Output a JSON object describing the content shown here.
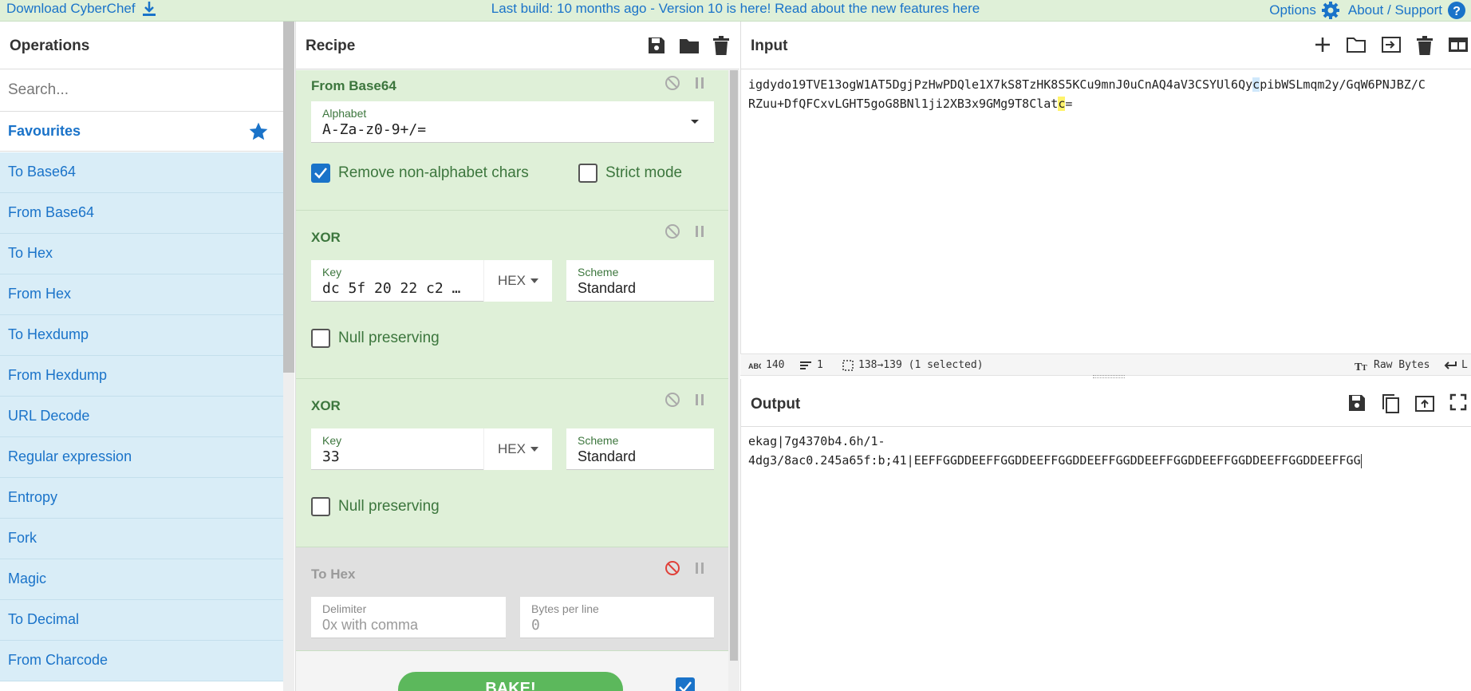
{
  "banner": {
    "download": "Download CyberChef",
    "message": "Last build: 10 months ago - Version 10 is here! Read about the new features here",
    "options": "Options",
    "about": "About / Support"
  },
  "operations": {
    "title": "Operations",
    "search_placeholder": "Search...",
    "favourites": "Favourites",
    "items": [
      "To Base64",
      "From Base64",
      "To Hex",
      "From Hex",
      "To Hexdump",
      "From Hexdump",
      "URL Decode",
      "Regular expression",
      "Entropy",
      "Fork",
      "Magic",
      "To Decimal",
      "From Charcode"
    ]
  },
  "recipe": {
    "title": "Recipe",
    "ops": [
      {
        "name": "From Base64",
        "alphabet_label": "Alphabet",
        "alphabet_value": "A-Za-z0-9+/=",
        "remove_label": "Remove non-alphabet chars",
        "strict_label": "Strict mode"
      },
      {
        "name": "XOR",
        "key_label": "Key",
        "key_value": "dc 5f 20 22 c2 …",
        "key_format": "HEX",
        "scheme_label": "Scheme",
        "scheme_value": "Standard",
        "null_label": "Null preserving"
      },
      {
        "name": "XOR",
        "key_label": "Key",
        "key_value": "33",
        "key_format": "HEX",
        "scheme_label": "Scheme",
        "scheme_value": "Standard",
        "null_label": "Null preserving"
      },
      {
        "name": "To Hex",
        "delimiter_label": "Delimiter",
        "delimiter_value": "0x with comma",
        "bytes_label": "Bytes per line",
        "bytes_value": "0"
      }
    ],
    "bake_label": "BAKE!"
  },
  "input": {
    "title": "Input",
    "line1_a": "igdydo19TVE13ogW1AT5DgjPzHwPDQle1X7kS8TzHK8S5KCu9mnJ0uCnAQ4aV3CSYUl6Qy",
    "line1_hl": "c",
    "line1_b": "pibWSLmqm2y/GqW6PNJBZ/C",
    "line2_a": "RZuu+DfQFCxvLGHT5goG8BNl1ji2XB3x9GMg9T8Clat",
    "line2_hl": "c",
    "line2_b": "="
  },
  "status": {
    "length": "140",
    "lines": "1",
    "selection": "138→139 (1 selected)",
    "encoding": "Raw Bytes",
    "eol": "L"
  },
  "output": {
    "title": "Output",
    "line1": "ekag|7g4370b4.6h/1-",
    "line2": "4dg3/8ac0.245a65f:b;41|EEFFGGDDEEFFGGDDEEFFGGDDEEFFGGDDEEFFGGDDEEFFGGDDEEFFGGDDEEFFGG"
  },
  "colors": {
    "accent": "#1a73c9",
    "op_green": "#dff0d8",
    "fav_blue": "#d9edf7",
    "bake": "#5cb85c"
  }
}
